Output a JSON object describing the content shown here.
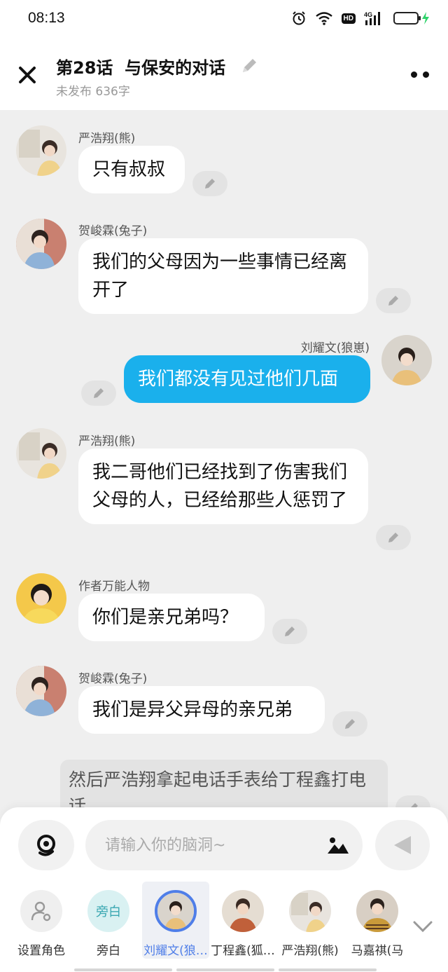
{
  "status_bar": {
    "time": "08:13",
    "icons": [
      "alarm-icon",
      "wifi-icon",
      "hd-badge",
      "signal-4g-icon",
      "battery-charging-icon"
    ],
    "hd_label": "HD",
    "network_label": "4G"
  },
  "header": {
    "title": "第28话  与保安的对话",
    "subtitle": "未发布 636字",
    "icons": [
      "close-icon",
      "pencil-icon",
      "more-icon"
    ]
  },
  "messages": [
    {
      "speaker": "严浩翔(熊)",
      "text": "只有叔叔",
      "side": "left"
    },
    {
      "speaker": "贺峻霖(兔子)",
      "text": "我们的父母因为一些事情已经离开了",
      "side": "left"
    },
    {
      "speaker": "刘耀文(狼崽)",
      "text": "我们都没有见过他们几面",
      "side": "right"
    },
    {
      "speaker": "严浩翔(熊)",
      "text": "我二哥他们已经找到了伤害我们父母的人，已经给那些人惩罚了",
      "side": "left"
    },
    {
      "speaker": "作者万能人物",
      "text": "你们是亲兄弟吗？",
      "side": "left"
    },
    {
      "speaker": "贺峻霖(兔子)",
      "text": "我们是异父异母的亲兄弟",
      "side": "left"
    }
  ],
  "narration": "然后严浩翔拿起电话手表给丁程鑫打电话",
  "composer": {
    "placeholder": "请输入你的脑洞~",
    "icons": [
      "voice-icon",
      "image-icon",
      "send-icon"
    ]
  },
  "roles": [
    {
      "label": "设置角色",
      "selected": false
    },
    {
      "label": "旁白",
      "avatar_text": "旁白",
      "selected": false
    },
    {
      "label": "刘耀文(狼…",
      "selected": true
    },
    {
      "label": "丁程鑫(狐…",
      "selected": false
    },
    {
      "label": "严浩翔(熊)",
      "selected": false
    },
    {
      "label": "马嘉祺(马",
      "selected": false
    }
  ],
  "colors": {
    "accent_blue": "#1ab0ec",
    "selected_role": "#4f7ee8",
    "background": "#efefef"
  }
}
